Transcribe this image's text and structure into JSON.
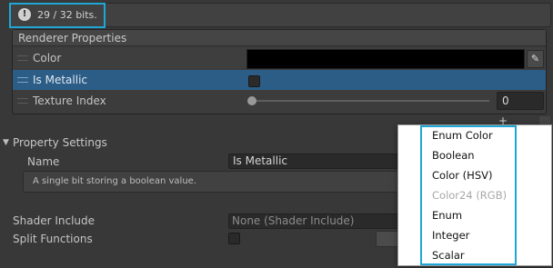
{
  "info_bar": {
    "bits_label": "29 / 32 bits.",
    "icon": "info-icon"
  },
  "renderer_properties": {
    "title": "Renderer Properties",
    "color": {
      "label": "Color",
      "value_color": "#000000",
      "picker_icon": "eyedropper-icon"
    },
    "is_metallic": {
      "label": "Is Metallic",
      "checked": false
    },
    "texture_index": {
      "label": "Texture Index",
      "value": "0",
      "slider_fraction": 0
    }
  },
  "property_settings": {
    "title": "Property Settings",
    "name_label": "Name",
    "name_value": "Is Metallic",
    "description": "A single bit storing a boolean value.",
    "shader_include_label": "Shader Include",
    "shader_include_value": "None (Shader Include)",
    "split_functions_label": "Split Functions",
    "split_functions_checked": false
  },
  "dropdown_menu": {
    "items": [
      {
        "label": "Enum Color",
        "enabled": true
      },
      {
        "label": "Boolean",
        "enabled": true
      },
      {
        "label": "Color (HSV)",
        "enabled": true
      },
      {
        "label": "Color24 (RGB)",
        "enabled": false
      },
      {
        "label": "Enum",
        "enabled": true
      },
      {
        "label": "Integer",
        "enabled": true
      },
      {
        "label": "Scalar",
        "enabled": true
      }
    ]
  },
  "colors": {
    "highlight": "#1ea7d6",
    "selected_row": "#2c5d87"
  }
}
